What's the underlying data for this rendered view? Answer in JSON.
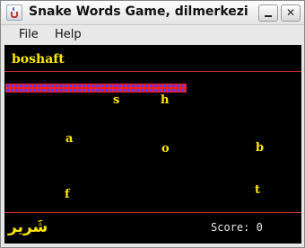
{
  "window": {
    "title": "Snake Words Game, dilmerkezi.i",
    "controls": {
      "minimize_icon": "minimize-icon",
      "close_label": "✕"
    }
  },
  "menu": {
    "items": [
      "File",
      "Help"
    ]
  },
  "game": {
    "target_word": "boshaft",
    "letters": [
      "s",
      "h",
      "a",
      "o",
      "b",
      "f",
      "t"
    ],
    "translation": "شَرير",
    "score_label": "Score: 0",
    "colors": {
      "background": "#000000",
      "text": "#ffe800",
      "divider": "#cc2b2b",
      "snake_red": "#ff1a1a",
      "snake_blue": "#4a3cff"
    }
  }
}
